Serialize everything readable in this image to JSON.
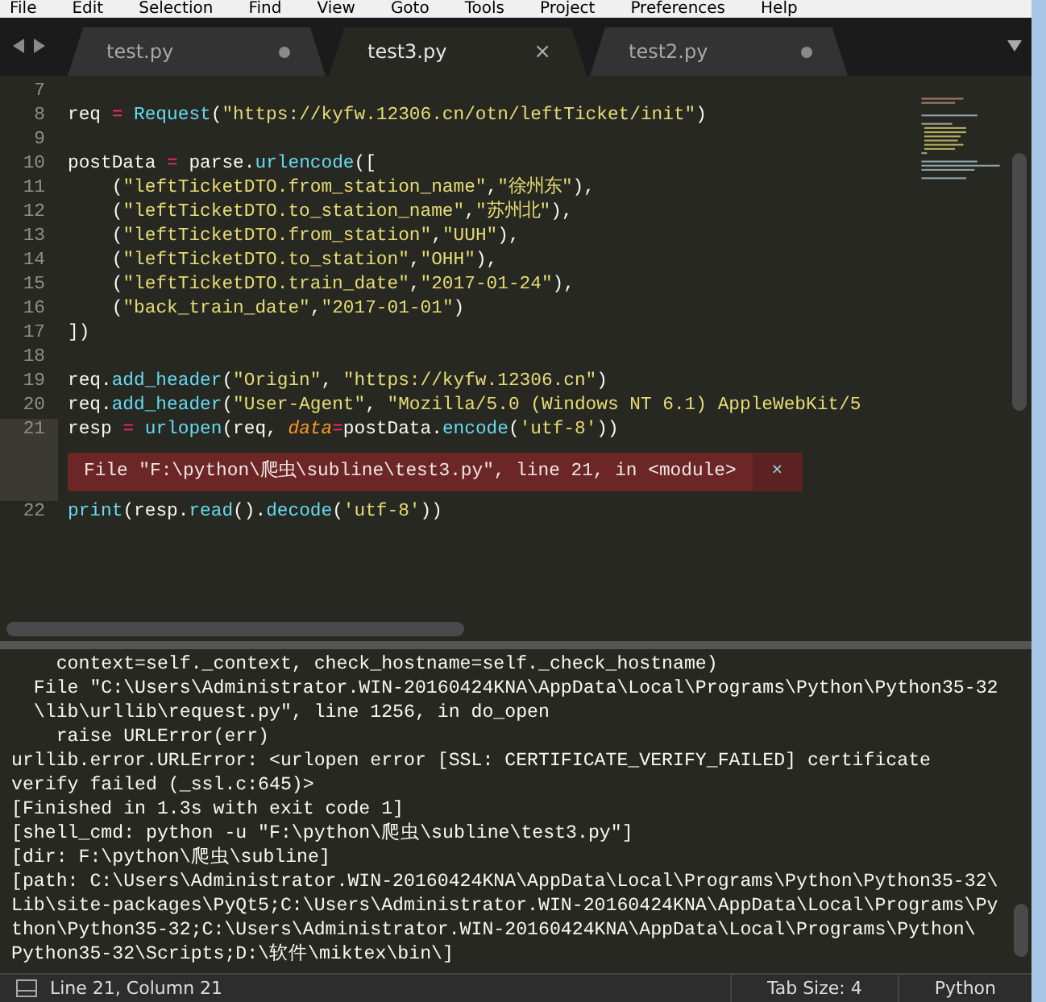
{
  "menu": [
    "File",
    "Edit",
    "Selection",
    "Find",
    "View",
    "Goto",
    "Tools",
    "Project",
    "Preferences",
    "Help"
  ],
  "tabs": [
    {
      "label": "test.py",
      "selected": false,
      "modified": true
    },
    {
      "label": "test3.py",
      "selected": true,
      "modified": false,
      "close": "×"
    },
    {
      "label": "test2.py",
      "selected": false,
      "modified": true
    }
  ],
  "editor": {
    "lines": [
      {
        "kind": "code",
        "number": "7",
        "current": false
      },
      {
        "kind": "code",
        "number": "8",
        "current": false,
        "tokens": [
          {
            "kind": "plain",
            "text": "req "
          },
          {
            "kind": "op",
            "text": "= "
          },
          {
            "kind": "func",
            "text": "Request"
          },
          {
            "kind": "plain",
            "text": "("
          },
          {
            "kind": "string",
            "text": "\"https://kyfw.12306.cn/otn/leftTicket/init\""
          },
          {
            "kind": "plain",
            "text": ")"
          }
        ]
      },
      {
        "kind": "code",
        "number": "9",
        "current": false
      },
      {
        "kind": "code",
        "number": "10",
        "current": false,
        "tokens": [
          {
            "kind": "plain",
            "text": "postData "
          },
          {
            "kind": "op",
            "text": "="
          },
          {
            "kind": "plain",
            "text": " parse."
          },
          {
            "kind": "func",
            "text": "urlencode"
          },
          {
            "kind": "plain",
            "text": "(["
          }
        ]
      },
      {
        "kind": "code",
        "number": "11",
        "current": false,
        "tokens": [
          {
            "kind": "plain",
            "text": "    ("
          },
          {
            "kind": "string",
            "text": "\"leftTicketDTO.from_station_name\""
          },
          {
            "kind": "plain",
            "text": ","
          },
          {
            "kind": "string",
            "text": "\"徐州东\""
          },
          {
            "kind": "plain",
            "text": "),"
          }
        ]
      },
      {
        "kind": "code",
        "number": "12",
        "current": false,
        "tokens": [
          {
            "kind": "plain",
            "text": "    ("
          },
          {
            "kind": "string",
            "text": "\"leftTicketDTO.to_station_name\""
          },
          {
            "kind": "plain",
            "text": ","
          },
          {
            "kind": "string",
            "text": "\"苏州北\""
          },
          {
            "kind": "plain",
            "text": "),"
          }
        ]
      },
      {
        "kind": "code",
        "number": "13",
        "current": false,
        "tokens": [
          {
            "kind": "plain",
            "text": "    ("
          },
          {
            "kind": "string",
            "text": "\"leftTicketDTO.from_station\""
          },
          {
            "kind": "plain",
            "text": ","
          },
          {
            "kind": "string",
            "text": "\"UUH\""
          },
          {
            "kind": "plain",
            "text": "),"
          }
        ]
      },
      {
        "kind": "code",
        "number": "14",
        "current": false,
        "tokens": [
          {
            "kind": "plain",
            "text": "    ("
          },
          {
            "kind": "string",
            "text": "\"leftTicketDTO.to_station\""
          },
          {
            "kind": "plain",
            "text": ","
          },
          {
            "kind": "string",
            "text": "\"OHH\""
          },
          {
            "kind": "plain",
            "text": "),"
          }
        ]
      },
      {
        "kind": "code",
        "number": "15",
        "current": false,
        "tokens": [
          {
            "kind": "plain",
            "text": "    ("
          },
          {
            "kind": "string",
            "text": "\"leftTicketDTO.train_date\""
          },
          {
            "kind": "plain",
            "text": ","
          },
          {
            "kind": "string",
            "text": "\"2017-01-24\""
          },
          {
            "kind": "plain",
            "text": "),"
          }
        ]
      },
      {
        "kind": "code",
        "number": "16",
        "current": false,
        "tokens": [
          {
            "kind": "plain",
            "text": "    ("
          },
          {
            "kind": "string",
            "text": "\"back_train_date\""
          },
          {
            "kind": "plain",
            "text": ","
          },
          {
            "kind": "string",
            "text": "\"2017-01-01\""
          },
          {
            "kind": "plain",
            "text": ")"
          }
        ]
      },
      {
        "kind": "code",
        "number": "17",
        "current": false,
        "tokens": [
          {
            "kind": "plain",
            "text": "])"
          }
        ]
      },
      {
        "kind": "code",
        "number": "18",
        "current": false
      },
      {
        "kind": "code",
        "number": "19",
        "current": false,
        "tokens": [
          {
            "kind": "plain",
            "text": "req."
          },
          {
            "kind": "func",
            "text": "add_header"
          },
          {
            "kind": "plain",
            "text": "("
          },
          {
            "kind": "string",
            "text": "\"Origin\""
          },
          {
            "kind": "plain",
            "text": ", "
          },
          {
            "kind": "string",
            "text": "\"https://kyfw.12306.cn\""
          },
          {
            "kind": "plain",
            "text": ")"
          }
        ]
      },
      {
        "kind": "code",
        "number": "20",
        "current": false,
        "tokens": [
          {
            "kind": "plain",
            "text": "req."
          },
          {
            "kind": "func",
            "text": "add_header"
          },
          {
            "kind": "plain",
            "text": "("
          },
          {
            "kind": "string",
            "text": "\"User-Agent\""
          },
          {
            "kind": "plain",
            "text": ", "
          },
          {
            "kind": "string",
            "text": "\"Mozilla/5.0 (Windows NT 6.1) AppleWebKit/5"
          }
        ]
      },
      {
        "kind": "code",
        "number": "21",
        "current": true,
        "tokens": [
          {
            "kind": "plain",
            "text": "resp "
          },
          {
            "kind": "op",
            "text": "= "
          },
          {
            "kind": "func",
            "text": "urlopen"
          },
          {
            "kind": "plain",
            "text": "(req, "
          },
          {
            "kind": "param",
            "text": "data"
          },
          {
            "kind": "op",
            "text": "="
          },
          {
            "kind": "plain",
            "text": "postData."
          },
          {
            "kind": "func",
            "text": "encode"
          },
          {
            "kind": "plain",
            "text": "("
          },
          {
            "kind": "string",
            "text": "'utf-8'"
          },
          {
            "kind": "plain",
            "text": "))"
          }
        ]
      },
      {
        "kind": "error",
        "text": "File \"F:\\python\\爬虫\\subline\\test3.py\", line 21, in <module>",
        "close": "×"
      },
      {
        "kind": "code",
        "number": "22",
        "current": false,
        "tokens": [
          {
            "kind": "func",
            "text": "print"
          },
          {
            "kind": "plain",
            "text": "(resp."
          },
          {
            "kind": "func",
            "text": "read"
          },
          {
            "kind": "plain",
            "text": "()."
          },
          {
            "kind": "func",
            "text": "decode"
          },
          {
            "kind": "plain",
            "text": "("
          },
          {
            "kind": "string",
            "text": "'utf-8'"
          },
          {
            "kind": "plain",
            "text": "))"
          }
        ]
      }
    ]
  },
  "console": {
    "lines": [
      "    context=self._context, check_hostname=self._check_hostname)",
      "  File \"C:\\Users\\Administrator.WIN-20160424KNA\\AppData\\Local\\Programs\\Python\\Python35-32",
      "  \\lib\\urllib\\request.py\", line 1256, in do_open",
      "    raise URLError(err)",
      "urllib.error.URLError: <urlopen error [SSL: CERTIFICATE_VERIFY_FAILED] certificate",
      "verify failed (_ssl.c:645)>",
      "[Finished in 1.3s with exit code 1]",
      "[shell_cmd: python -u \"F:\\python\\爬虫\\subline\\test3.py\"]",
      "[dir: F:\\python\\爬虫\\subline]",
      "[path: C:\\Users\\Administrator.WIN-20160424KNA\\AppData\\Local\\Programs\\Python\\Python35-32\\",
      "Lib\\site-packages\\PyQt5;C:\\Users\\Administrator.WIN-20160424KNA\\AppData\\Local\\Programs\\Py",
      "thon\\Python35-32;C:\\Users\\Administrator.WIN-20160424KNA\\AppData\\Local\\Programs\\Python\\",
      "Python35-32\\Scripts;D:\\软件\\miktex\\bin\\]"
    ]
  },
  "status_bar": {
    "position": "Line 21, Column 21",
    "tab_size": "Tab Size: 4",
    "syntax": "Python"
  }
}
